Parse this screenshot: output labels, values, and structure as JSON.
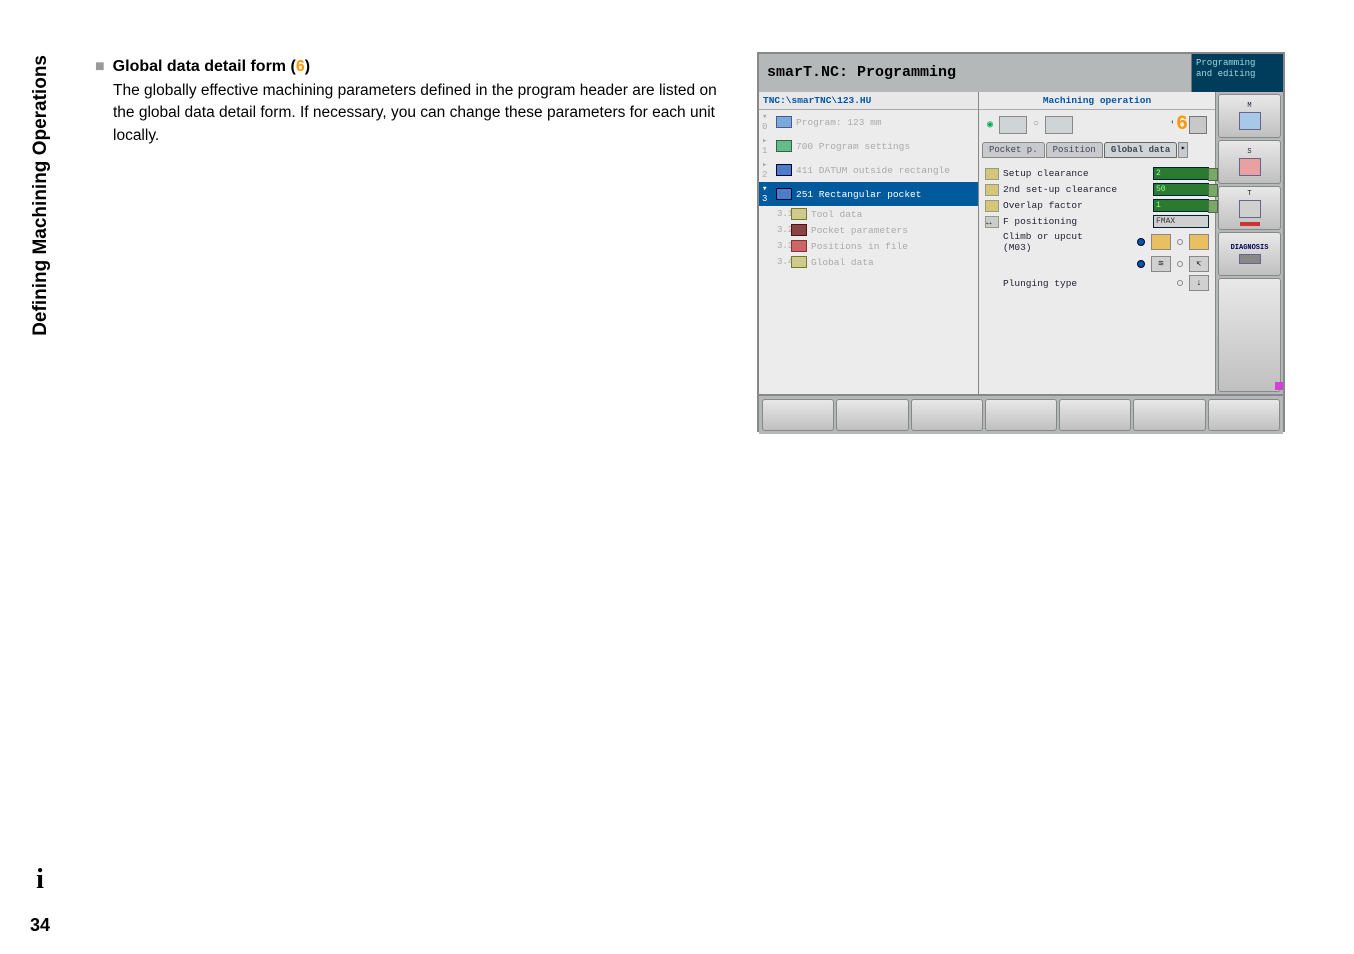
{
  "sidebar": {
    "section_title": "Defining Machining Operations"
  },
  "content": {
    "bullet": "■",
    "heading": "Global data detail form",
    "heading_paren_open": " (",
    "heading_num": "6",
    "heading_paren_close": ")",
    "body": "The globally effective machining parameters defined in the program header are listed on the global data detail form. If necessary, you can change these parameters for each unit locally."
  },
  "screenshot": {
    "title": "smarT.NC: Programming",
    "mode_line1": "Programming",
    "mode_line2": "and editing",
    "path": "TNC:\\smarTNC\\123.HU",
    "tree": {
      "r0": {
        "arrow": "▾ 0",
        "label": "Program: 123 mm"
      },
      "r1": {
        "arrow": "▸ 1",
        "label": "700 Program settings"
      },
      "r2": {
        "arrow": "▸ 2",
        "label": "411 DATUM outside rectangle"
      },
      "r3": {
        "arrow": "▾ 3",
        "label": "251 Rectangular pocket"
      },
      "r31": {
        "arrow": "3.1",
        "label": "Tool data"
      },
      "r32": {
        "arrow": "3.2",
        "label": "Pocket parameters"
      },
      "r33": {
        "arrow": "3.3",
        "label": "Positions in file"
      },
      "r34": {
        "arrow": "3.4",
        "label": "Global data"
      }
    },
    "mid": {
      "title": "Machining operation",
      "big6": "6",
      "tabs": {
        "a": "Pocket p.",
        "b": "Position",
        "c": "Global data"
      },
      "rows": {
        "setup": "Setup clearance",
        "second": "2nd set-up clearance",
        "overlap": "Overlap factor",
        "fpos": "F positioning",
        "fpos_val": "FMAX",
        "climb": "Climb or upcut (M03)",
        "plunge": "Plunging type"
      },
      "val_setup": "2",
      "val_second": "50",
      "val_overlap": "1"
    },
    "right": {
      "m": "M",
      "s": "S",
      "t": "T",
      "diag": "DIAGNOSIS"
    }
  },
  "footer": {
    "info": "i",
    "page": "34"
  }
}
